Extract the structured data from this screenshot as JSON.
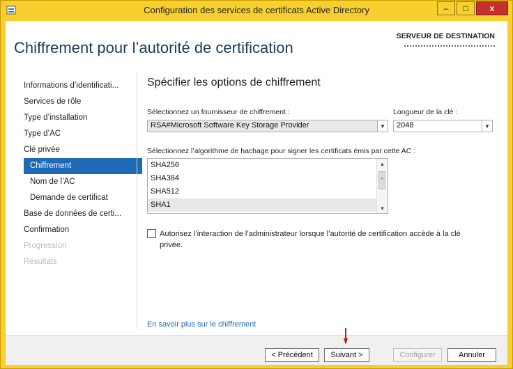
{
  "window": {
    "title": "Configuration des services de certificats Active Directory",
    "minimize_label": "–",
    "maximize_label": "□",
    "close_label": "x"
  },
  "header": {
    "title": "Chiffrement pour l’autorité de certification",
    "server_label": "SERVEUR DE DESTINATION"
  },
  "nav": {
    "items": [
      {
        "label": "Informations d’identificati..."
      },
      {
        "label": "Services de rôle"
      },
      {
        "label": "Type d’installation"
      },
      {
        "label": "Type d’AC"
      },
      {
        "label": "Clé privée"
      },
      {
        "label": "Chiffrement"
      },
      {
        "label": "Nom de l’AC"
      },
      {
        "label": "Demande de certificat"
      },
      {
        "label": "Base de données de certi..."
      },
      {
        "label": "Confirmation"
      },
      {
        "label": "Progression"
      },
      {
        "label": "Résultats"
      }
    ]
  },
  "main": {
    "section_title": "Spécifier les options de chiffrement",
    "provider_label": "Sélectionnez un fournisseur de chiffrement :",
    "provider_value": "RSA#Microsoft Software Key Storage Provider",
    "key_length_label": "Longueur de la clé :",
    "key_length_value": "2048",
    "hash_label": "Sélectionnez l’algorithme de hachage pour signer les certificats émis par cette AC :",
    "hash_options": [
      "SHA256",
      "SHA384",
      "SHA512",
      "SHA1"
    ],
    "hash_selected": "SHA1",
    "checkbox_label_line1": "Autorisez l’interaction de l’administrateur lorsque l’autorité de certification accède à la clé",
    "checkbox_label_line2": "privée.",
    "checkbox_checked": false,
    "learn_more_link": "En savoir plus sur le chiffrement"
  },
  "footer": {
    "previous_label": "< Précédent",
    "next_label": "Suivant >",
    "configure_label": "Configurer",
    "cancel_label": "Annuler"
  },
  "colors": {
    "titlebar": "#f7cf2e",
    "accent": "#1e6ab6",
    "close": "#c7312b",
    "annotation_arrow": "#c0181b"
  }
}
